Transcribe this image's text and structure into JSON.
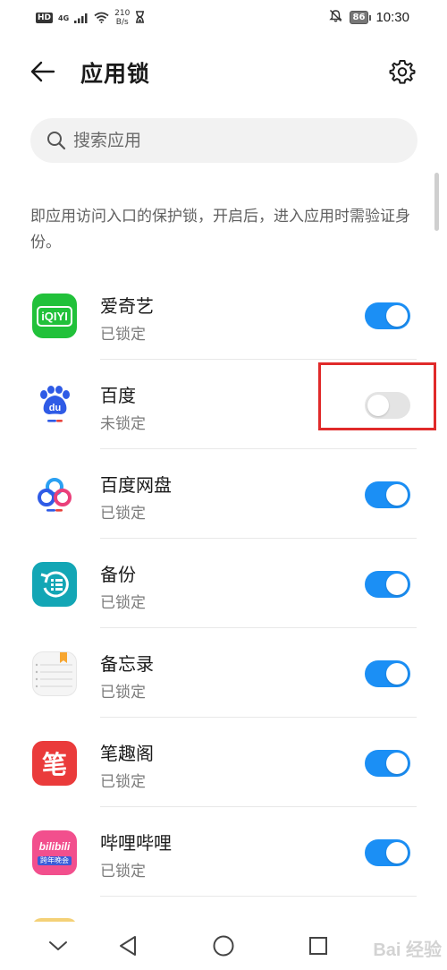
{
  "status_bar": {
    "hd": "HD",
    "network": "4G",
    "speed_value": "210",
    "speed_unit": "B/s",
    "battery": "86",
    "time": "10:30",
    "icons": [
      "signal-icon",
      "wifi-icon",
      "hourglass-icon",
      "mute-bell-icon",
      "battery-icon"
    ]
  },
  "header": {
    "title": "应用锁",
    "back_icon": "arrow-left-icon",
    "settings_icon": "gear-icon"
  },
  "search": {
    "placeholder": "搜索应用",
    "icon": "search-icon"
  },
  "description": "即应用访问入口的保护锁，开启后，进入应用时需验证身份。",
  "apps": [
    {
      "name": "爱奇艺",
      "status": "已锁定",
      "enabled": true,
      "icon": "iqiyi-icon",
      "icon_text": "iQIYI",
      "color": "#21c13a"
    },
    {
      "name": "百度",
      "status": "未锁定",
      "enabled": false,
      "icon": "baidu-icon",
      "icon_text": "du",
      "color": "#2f5be6"
    },
    {
      "name": "百度网盘",
      "status": "已锁定",
      "enabled": true,
      "icon": "baidu-netdisk-icon",
      "color": "#2aa0f2"
    },
    {
      "name": "备份",
      "status": "已锁定",
      "enabled": true,
      "icon": "backup-icon",
      "color": "#13a6b5"
    },
    {
      "name": "备忘录",
      "status": "已锁定",
      "enabled": true,
      "icon": "memo-icon",
      "color": "#f7a630"
    },
    {
      "name": "笔趣阁",
      "status": "已锁定",
      "enabled": true,
      "icon": "biquge-icon",
      "icon_text": "笔",
      "color": "#ea3b3b"
    },
    {
      "name": "哔哩哔哩",
      "status": "已锁定",
      "enabled": true,
      "icon": "bilibili-icon",
      "icon_text": "bilibili",
      "icon_subtext": "跨年晚会",
      "color": "#f24f8d"
    }
  ],
  "nav": {
    "icons": [
      "chevron-down-icon",
      "back-triangle-icon",
      "home-circle-icon",
      "recents-square-icon"
    ]
  },
  "watermark": "Bai 经验",
  "colors": {
    "toggle_on": "#1b8ff5",
    "toggle_off": "#e4e4e4",
    "highlight": "#e02a2a"
  }
}
